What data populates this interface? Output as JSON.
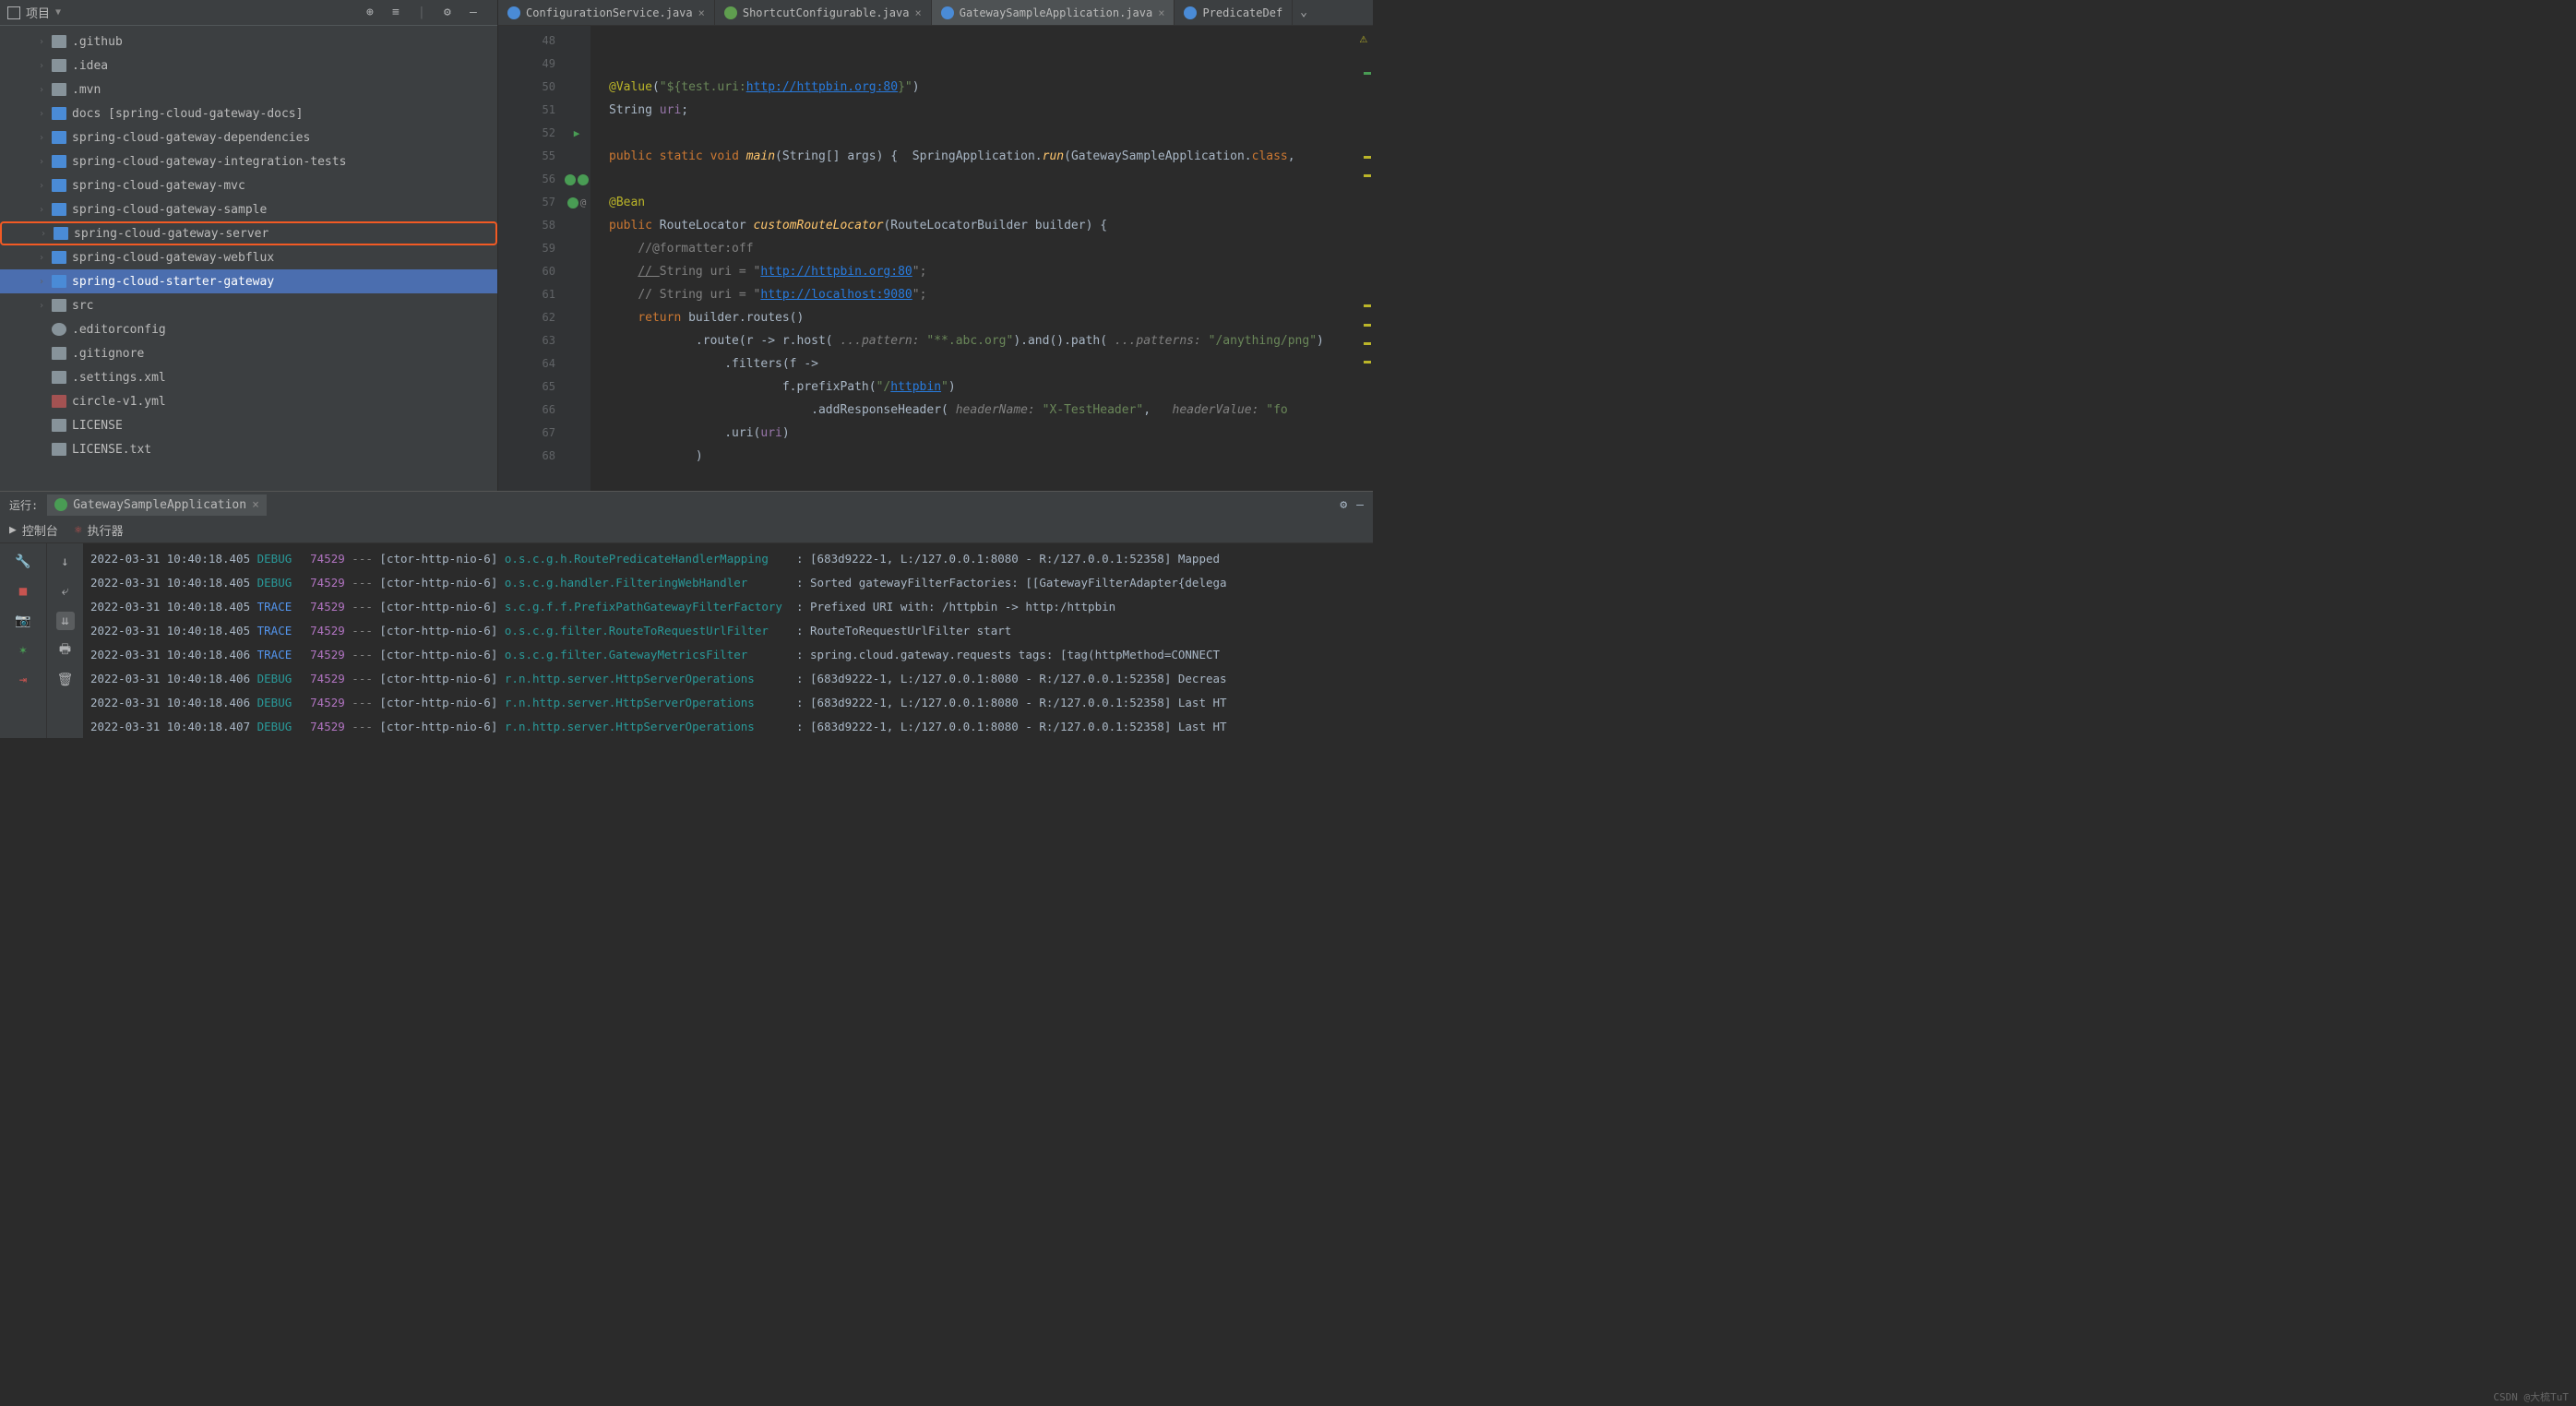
{
  "project": {
    "title": "项目",
    "items": [
      {
        "name": ".github",
        "icon": "folder",
        "chev": true
      },
      {
        "name": ".idea",
        "icon": "folder",
        "chev": true
      },
      {
        "name": ".mvn",
        "icon": "folder",
        "chev": true
      },
      {
        "name": "docs [spring-cloud-gateway-docs]",
        "icon": "module",
        "chev": true
      },
      {
        "name": "spring-cloud-gateway-dependencies",
        "icon": "module",
        "chev": true
      },
      {
        "name": "spring-cloud-gateway-integration-tests",
        "icon": "module",
        "chev": true
      },
      {
        "name": "spring-cloud-gateway-mvc",
        "icon": "module",
        "chev": true
      },
      {
        "name": "spring-cloud-gateway-sample",
        "icon": "module",
        "chev": true
      },
      {
        "name": "spring-cloud-gateway-server",
        "icon": "module",
        "chev": true,
        "highlight": true
      },
      {
        "name": "spring-cloud-gateway-webflux",
        "icon": "module",
        "chev": true
      },
      {
        "name": "spring-cloud-starter-gateway",
        "icon": "module",
        "chev": true,
        "selected": true
      },
      {
        "name": "src",
        "icon": "folder",
        "chev": true
      },
      {
        "name": ".editorconfig",
        "icon": "gear",
        "chev": false
      },
      {
        "name": ".gitignore",
        "icon": "file",
        "chev": false
      },
      {
        "name": ".settings.xml",
        "icon": "file",
        "chev": false
      },
      {
        "name": "circle-v1.yml",
        "icon": "yml",
        "chev": false
      },
      {
        "name": "LICENSE",
        "icon": "file",
        "chev": false
      },
      {
        "name": "LICENSE.txt",
        "icon": "file",
        "chev": false
      }
    ]
  },
  "tabs": [
    {
      "label": "ConfigurationService.java",
      "icon": "c"
    },
    {
      "label": "ShortcutConfigurable.java",
      "icon": "i"
    },
    {
      "label": "GatewaySampleApplication.java",
      "icon": "c",
      "active": true
    },
    {
      "label": "PredicateDef",
      "icon": "c",
      "truncated": true
    }
  ],
  "editor": {
    "lines": [
      "48",
      "49",
      "50",
      "51",
      "52",
      "55",
      "56",
      "57",
      "58",
      "59",
      "60",
      "61",
      "62",
      "63",
      "64",
      "65",
      "66",
      "67",
      "68"
    ],
    "code": {
      "l49_ann": "@Value",
      "l49_str1": "\"${test.uri:",
      "l49_link": "http://httpbin.org:80",
      "l49_str2": "}\"",
      "l50_type": "String ",
      "l50_id": "uri",
      "l52_pub": "public ",
      "l52_stat": "static ",
      "l52_void": "void ",
      "l52_main": "main",
      "l52_sig": "(String[] args) {  SpringApplication.",
      "l52_run": "run",
      "l52_rest": "(GatewaySampleApplication.",
      "l52_cls": "class",
      "l56_bean": "@Bean",
      "l57_pub": "public ",
      "l57_ret": "RouteLocator ",
      "l57_meth": "customRouteLocator",
      "l57_sig": "(RouteLocatorBuilder builder) {",
      "l58_cmt": "//@formatter:off",
      "l59_cmt1": "// ",
      "l59_cmt2": "String uri = \"",
      "l59_lnk": "http://httpbin.org:80",
      "l59_cmt3": "\";",
      "l60_cmt1": "// String uri = \"",
      "l60_lnk": "http://localhost:9080",
      "l60_cmt2": "\";",
      "l61_ret": "return ",
      "l61_txt": "builder.routes()",
      "l62_txt1": ".route(r -> r.host( ",
      "l62_p1": "...pattern:",
      "l62_v1": " \"**.abc.org\"",
      "l62_txt2": ").and().path( ",
      "l62_p2": "...patterns:",
      "l62_v2": " \"/anything/png\"",
      "l62_txt3": ")",
      "l63_txt": ".filters(f ->",
      "l64_txt1": "f.prefixPath(",
      "l64_str": "\"/",
      "l64_lnk": "httpbin",
      "l64_str2": "\"",
      "l64_txt2": ")",
      "l65_txt1": ".addResponseHeader( ",
      "l65_p1": "headerName:",
      "l65_v1": " \"X-TestHeader\"",
      "l65_sep": ",   ",
      "l65_p2": "headerValue:",
      "l65_v2": " \"fo",
      "l66_txt1": ".uri(",
      "l66_id": "uri",
      "l66_txt2": ")",
      "l67_txt": ")"
    }
  },
  "run": {
    "label": "运行:",
    "tab": "GatewaySampleApplication",
    "subtabs": [
      "控制台",
      "执行器"
    ],
    "logs": [
      {
        "ts": "2022-03-31 10:40:18.405",
        "lvl": "DEBUG",
        "pid": "74529",
        "thr": "[ctor-http-nio-6]",
        "log": "o.s.c.g.h.RoutePredicateHandlerMapping  ",
        "msg": ": [683d9222-1, L:/127.0.0.1:8080 - R:/127.0.0.1:52358] Mapped"
      },
      {
        "ts": "2022-03-31 10:40:18.405",
        "lvl": "DEBUG",
        "pid": "74529",
        "thr": "[ctor-http-nio-6]",
        "log": "o.s.c.g.handler.FilteringWebHandler     ",
        "msg": ": Sorted gatewayFilterFactories: [[GatewayFilterAdapter{delega"
      },
      {
        "ts": "2022-03-31 10:40:18.405",
        "lvl": "TRACE",
        "pid": "74529",
        "thr": "[ctor-http-nio-6]",
        "log": "s.c.g.f.f.PrefixPathGatewayFilterFactory",
        "msg": ": Prefixed URI with: /httpbin -> http:/httpbin"
      },
      {
        "ts": "2022-03-31 10:40:18.405",
        "lvl": "TRACE",
        "pid": "74529",
        "thr": "[ctor-http-nio-6]",
        "log": "o.s.c.g.filter.RouteToRequestUrlFilter  ",
        "msg": ": RouteToRequestUrlFilter start"
      },
      {
        "ts": "2022-03-31 10:40:18.406",
        "lvl": "TRACE",
        "pid": "74529",
        "thr": "[ctor-http-nio-6]",
        "log": "o.s.c.g.filter.GatewayMetricsFilter     ",
        "msg": ": spring.cloud.gateway.requests tags: [tag(httpMethod=CONNECT"
      },
      {
        "ts": "2022-03-31 10:40:18.406",
        "lvl": "DEBUG",
        "pid": "74529",
        "thr": "[ctor-http-nio-6]",
        "log": "r.n.http.server.HttpServerOperations    ",
        "msg": ": [683d9222-1, L:/127.0.0.1:8080 - R:/127.0.0.1:52358] Decreas"
      },
      {
        "ts": "2022-03-31 10:40:18.406",
        "lvl": "DEBUG",
        "pid": "74529",
        "thr": "[ctor-http-nio-6]",
        "log": "r.n.http.server.HttpServerOperations    ",
        "msg": ": [683d9222-1, L:/127.0.0.1:8080 - R:/127.0.0.1:52358] Last HT"
      },
      {
        "ts": "2022-03-31 10:40:18.407",
        "lvl": "DEBUG",
        "pid": "74529",
        "thr": "[ctor-http-nio-6]",
        "log": "r.n.http.server.HttpServerOperations    ",
        "msg": ": [683d9222-1, L:/127.0.0.1:8080 - R:/127.0.0.1:52358] Last HT"
      }
    ]
  },
  "watermark": "CSDN @大梳TuT"
}
